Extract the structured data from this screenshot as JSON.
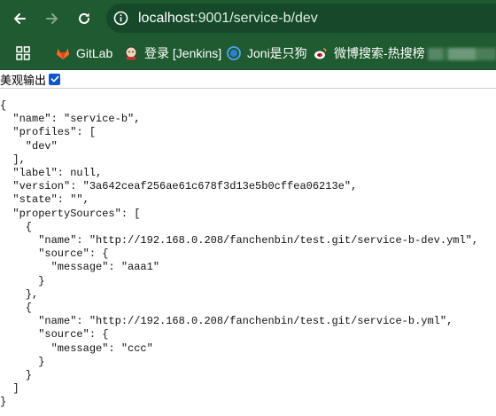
{
  "browser": {
    "url_host": "localhost",
    "url_rest": ":9001/service-b/dev"
  },
  "bookmarks": [
    {
      "label": "GitLab",
      "icon": "gitlab-icon"
    },
    {
      "label": "登录 [Jenkins]",
      "icon": "jenkins-icon"
    },
    {
      "label": "Joni是只狗",
      "icon": "globe-icon"
    },
    {
      "label": "微博搜索-热搜榜",
      "icon": "weibo-icon"
    }
  ],
  "pretty_print": {
    "label": "美观输出",
    "checked": true
  },
  "json_text": "{\n  \"name\": \"service-b\",\n  \"profiles\": [\n    \"dev\"\n  ],\n  \"label\": null,\n  \"version\": \"3a642ceaf256ae61c678f3d13e5b0cffea06213e\",\n  \"state\": \"\",\n  \"propertySources\": [\n    {\n      \"name\": \"http://192.168.0.208/fanchenbin/test.git/service-b-dev.yml\",\n      \"source\": {\n        \"message\": \"aaa1\"\n      }\n    },\n    {\n      \"name\": \"http://192.168.0.208/fanchenbin/test.git/service-b.yml\",\n      \"source\": {\n        \"message\": \"ccc\"\n      }\n    }\n  ]\n}",
  "colors": {
    "chrome_bg": "#1f5a30",
    "omnibox_bg": "#15492a",
    "checkbox": "#0b57d0"
  }
}
